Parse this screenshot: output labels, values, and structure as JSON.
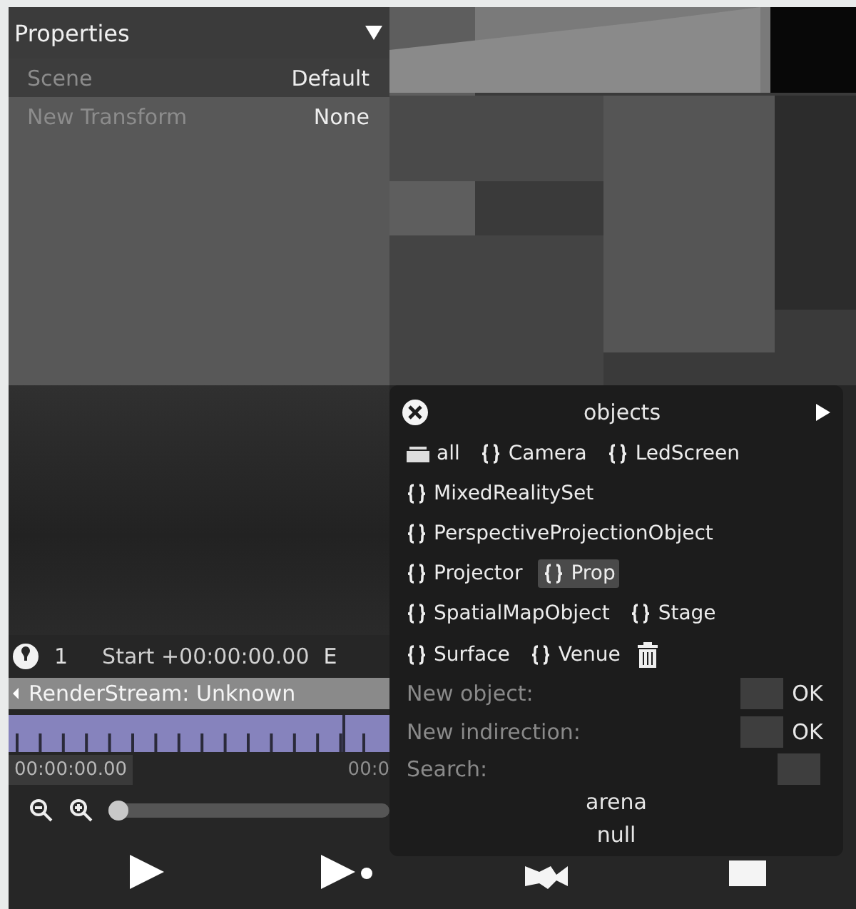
{
  "properties": {
    "title": "Properties",
    "rows": [
      {
        "label": "Scene",
        "value": "Default"
      },
      {
        "label": "New Transform",
        "value": "None"
      }
    ]
  },
  "timeline": {
    "track_number": "1",
    "start": "Start +00:00:00.00",
    "cut_label": "E",
    "track_name": "RenderStream: Unknown",
    "time_left": "00:00:00.00",
    "time_right": "00:0",
    "zoom": {
      "level": 0
    }
  },
  "popup": {
    "title": "objects",
    "type_rows": [
      [
        {
          "kind": "all",
          "label": "all",
          "selected": false
        },
        {
          "kind": "class",
          "label": "Camera",
          "selected": false
        },
        {
          "kind": "class",
          "label": "LedScreen",
          "selected": false
        }
      ],
      [
        {
          "kind": "class",
          "label": "MixedRealitySet",
          "selected": false
        }
      ],
      [
        {
          "kind": "class",
          "label": "PerspectiveProjectionObject",
          "selected": false
        }
      ],
      [
        {
          "kind": "class",
          "label": "Projector",
          "selected": false
        },
        {
          "kind": "class",
          "label": "Prop",
          "selected": true
        }
      ],
      [
        {
          "kind": "class",
          "label": "SpatialMapObject",
          "selected": false
        },
        {
          "kind": "class",
          "label": "Stage",
          "selected": false
        }
      ],
      [
        {
          "kind": "class",
          "label": "Surface",
          "selected": false
        },
        {
          "kind": "class",
          "label": "Venue",
          "selected": false
        },
        {
          "kind": "delete",
          "selected": false
        }
      ]
    ],
    "fields": [
      {
        "label": "New object:",
        "button": "OK"
      },
      {
        "label": "New indirection:",
        "button": "OK"
      },
      {
        "label": "Search:"
      }
    ],
    "results": [
      "arena",
      "null"
    ]
  }
}
